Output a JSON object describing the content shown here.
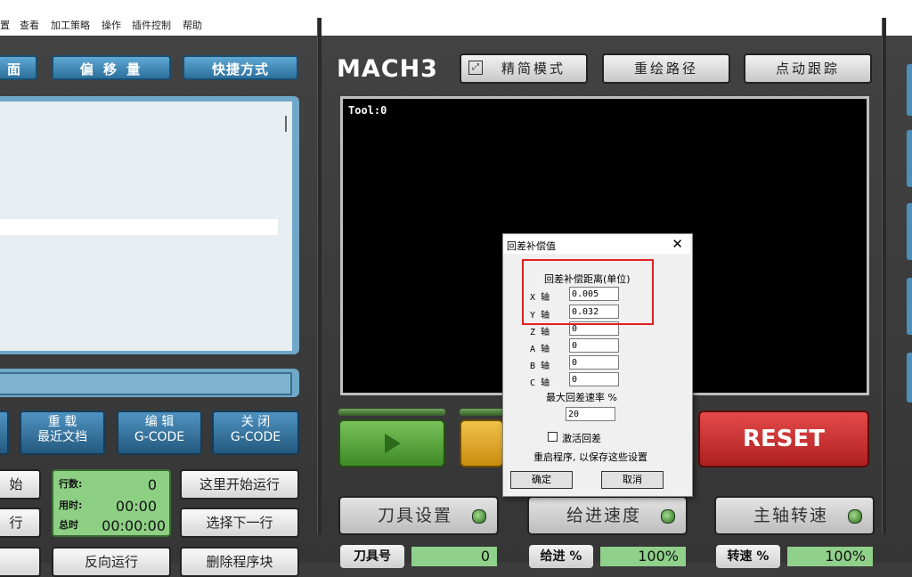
{
  "menu": [
    "置",
    "查看",
    "加工策略",
    "操作",
    "插件控制",
    "帮助"
  ],
  "top_tabs": [
    "面",
    "偏 移 量",
    "快捷方式"
  ],
  "logo_text": "MACH3",
  "screen_buttons": [
    "精简模式",
    "重绘路径",
    "点动跟踪"
  ],
  "toolpath_label": "Tool:0",
  "file_buttons": [
    {
      "line1": "重 载",
      "line2": "最近文档"
    },
    {
      "line1": "编 辑",
      "line2": "G-CODE"
    },
    {
      "line1": "关 闭",
      "line2": "G-CODE"
    }
  ],
  "left_buttons": {
    "start_partial": "始",
    "row_partial": "行",
    "bottom_partial": "",
    "run_from_here": "这里开始运行",
    "select_next": "选择下一行",
    "reverse_run": "反向运行",
    "delete_block": "删除程序块"
  },
  "status": {
    "line_label": "行数:",
    "line_value": "0",
    "time_label": "用时:",
    "time_value": "00:00",
    "total_label": "总时",
    "total_value": "00:00:00"
  },
  "reset_label": "RESET",
  "pill_buttons": [
    "刀具设置",
    "给进速度",
    "主轴转速"
  ],
  "bottom_labels": {
    "tool_no": "刀具号",
    "tool_value": "0",
    "feed_label": "给进 %",
    "feed_value": "100%",
    "speed_label": "转速 %",
    "speed_value": "100%"
  },
  "dialog": {
    "title": "回差补偿值",
    "close": "✕",
    "heading": "回差补偿距离(单位)",
    "axes": [
      {
        "label": "X 轴",
        "value": "0.005"
      },
      {
        "label": "Y 轴",
        "value": "0.032"
      },
      {
        "label": "Z 轴",
        "value": "0"
      },
      {
        "label": "A 轴",
        "value": "0"
      },
      {
        "label": "B 轴",
        "value": "0"
      },
      {
        "label": "C 轴",
        "value": "0"
      }
    ],
    "max_rate_label": "最大回差速率 %",
    "max_rate_value": "20",
    "activate_label": "激活回差",
    "restart_note": "重启程序, 以保存这些设置",
    "ok_label": "确定",
    "cancel_label": "取消"
  },
  "colors": {
    "accent_blue": "#2c6f9c",
    "reset_red": "#c62828",
    "highlight_red": "#e02020",
    "status_green": "#8dd084"
  }
}
